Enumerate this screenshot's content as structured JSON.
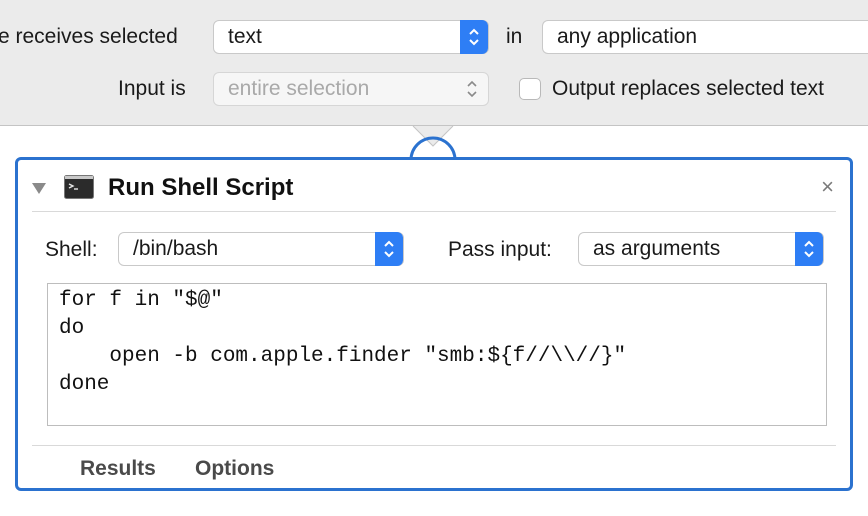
{
  "workflow_settings": {
    "receives_label": "e receives selected",
    "receives_value": "text",
    "in_label": "in",
    "app_value": "any application",
    "input_is_label": "Input is",
    "input_is_value": "entire selection",
    "output_replaces_label": "Output replaces selected text",
    "output_replaces_checked": false
  },
  "action": {
    "title": "Run Shell Script",
    "close_glyph": "×",
    "shell_label": "Shell:",
    "shell_value": "/bin/bash",
    "pass_input_label": "Pass input:",
    "pass_input_value": "as arguments",
    "script": "for f in \"$@\"\ndo\n    open -b com.apple.finder \"smb:${f//\\\\//}\"\ndone",
    "tabs": [
      "Results",
      "Options"
    ]
  },
  "colors": {
    "accent": "#2e7ef5",
    "selection_border": "#2b72cf",
    "panel_bg": "#ebebeb"
  },
  "icons": [
    "up-down-chevron-icon",
    "disclosure-triangle-icon",
    "terminal-icon",
    "close-icon"
  ]
}
